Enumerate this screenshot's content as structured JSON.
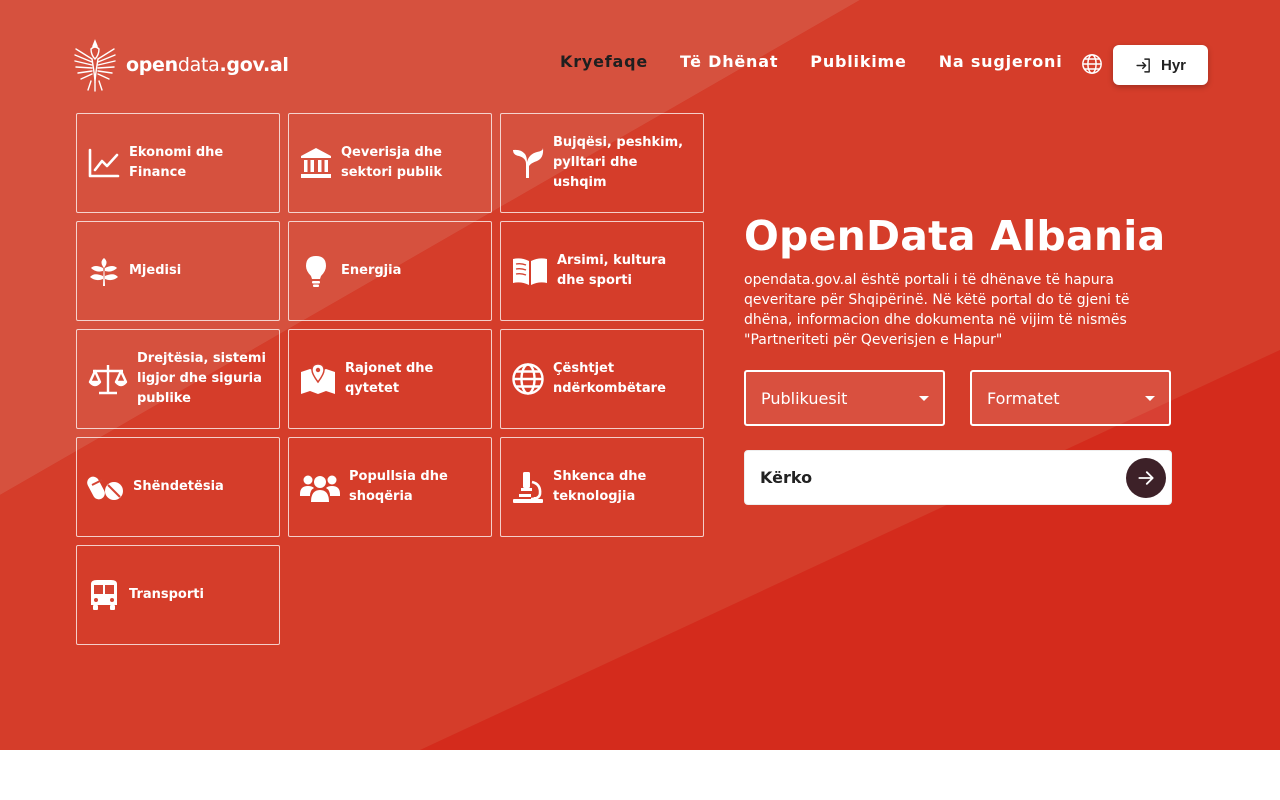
{
  "header": {
    "logo": {
      "bold_a": "open",
      "thin": "data",
      "bold_b": ".gov.al"
    },
    "nav": [
      {
        "label": "Kryefaqe",
        "active": true
      },
      {
        "label": "Të Dhënat",
        "active": false
      },
      {
        "label": "Publikime",
        "active": false
      },
      {
        "label": "Na sugjeroni",
        "active": false
      }
    ],
    "language_icon": "globe-icon",
    "login_label": "Hyr"
  },
  "categories": [
    {
      "label": "Ekonomi dhe Finance",
      "icon": "chart-line-icon"
    },
    {
      "label": "Qeverisja dhe sektori publik",
      "icon": "government-building-icon"
    },
    {
      "label": "Bujqësi, peshkim, pylltari dhe ushqim",
      "icon": "seedling-icon"
    },
    {
      "label": "Mjedisi",
      "icon": "leaf-branch-icon"
    },
    {
      "label": "Energjia",
      "icon": "lightbulb-icon"
    },
    {
      "label": "Arsimi, kultura dhe sporti",
      "icon": "open-book-icon"
    },
    {
      "label": "Drejtësia, sistemi ligjor dhe siguria publike",
      "icon": "scales-icon"
    },
    {
      "label": "Rajonet dhe qytetet",
      "icon": "map-pin-icon"
    },
    {
      "label": "Çështjet ndërkombëtare",
      "icon": "globe-icon"
    },
    {
      "label": "Shëndetësia",
      "icon": "pills-icon"
    },
    {
      "label": "Popullsia dhe shoqëria",
      "icon": "users-icon"
    },
    {
      "label": "Shkenca dhe teknologjia",
      "icon": "microscope-icon"
    },
    {
      "label": "Transporti",
      "icon": "bus-icon"
    }
  ],
  "hero": {
    "title": "OpenData Albania",
    "description": "opendata.gov.al është portali i të dhënave të hapura qeveritare për Shqipërinë. Në këtë portal do të gjeni të dhëna, informacion dhe dokumenta në vijim të nismës \"Partneriteti për Qeverisjen e Hapur\"",
    "publishers_select": "Publikuesit",
    "formats_select": "Formatet",
    "search_placeholder": "Kërko"
  },
  "colors": {
    "hero_base": "#d42b1c",
    "hero_light": "#d6513e",
    "search_button": "#3d2128"
  }
}
